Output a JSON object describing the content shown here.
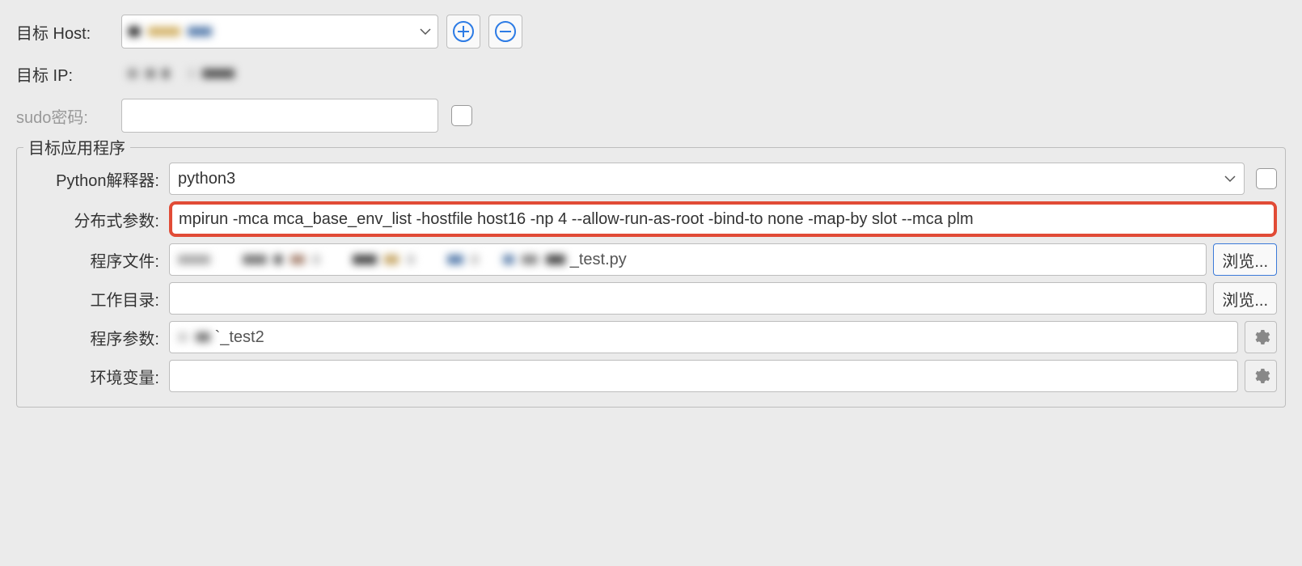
{
  "top": {
    "target_host_label": "目标 Host:",
    "target_host_value": "",
    "target_ip_label": "目标 IP:",
    "target_ip_value": "",
    "sudo_label": "sudo密码:",
    "sudo_value": ""
  },
  "icons": {
    "plus_name": "plus-icon",
    "minus_name": "minus-icon",
    "gear_name": "gear-icon",
    "dropdown_name": "chevron-down-icon"
  },
  "fieldset": {
    "legend": "目标应用程序",
    "python_label": "Python解释器:",
    "python_value": "python3",
    "dist_label": "分布式参数:",
    "dist_value": "mpirun -mca mca_base_env_list -hostfile host16 -np 4 --allow-run-as-root -bind-to none -map-by slot --mca plm",
    "file_label": "程序文件:",
    "file_suffix": "_test.py",
    "workdir_label": "工作目录:",
    "workdir_value": "",
    "args_label": "程序参数:",
    "args_suffix": "_test2",
    "env_label": "环境变量:",
    "env_value": "",
    "browse_label": "浏览..."
  }
}
